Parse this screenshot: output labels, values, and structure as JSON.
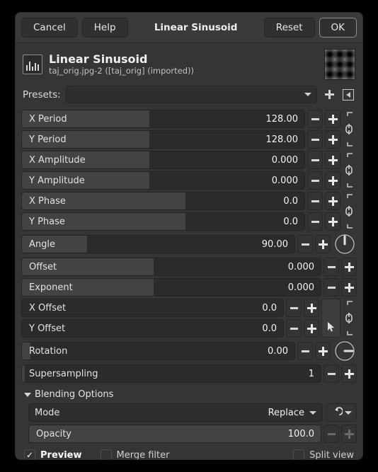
{
  "titlebar": {
    "cancel": "Cancel",
    "help": "Help",
    "title": "Linear Sinusoid",
    "reset": "Reset",
    "ok": "OK"
  },
  "info": {
    "title": "Linear Sinusoid",
    "subtitle": "taj_orig.jpg-2 ([taj_orig] (imported))"
  },
  "presets": {
    "label": "Presets:",
    "value": "",
    "add_icon": "plus-icon",
    "menu_icon": "preset-menu-icon"
  },
  "params": [
    {
      "label": "X Period",
      "value": "128.00",
      "fill": 45
    },
    {
      "label": "Y Period",
      "value": "128.00",
      "fill": 45
    },
    {
      "label": "X Amplitude",
      "value": "0.000",
      "fill": 45
    },
    {
      "label": "Y Amplitude",
      "value": "0.000",
      "fill": 45
    },
    {
      "label": "X Phase",
      "value": "0.0",
      "fill": 58
    },
    {
      "label": "Y Phase",
      "value": "0.0",
      "fill": 58
    },
    {
      "label": "Angle",
      "value": "90.00",
      "fill": 24
    },
    {
      "label": "Offset",
      "value": "0.000",
      "fill": 44
    },
    {
      "label": "Exponent",
      "value": "0.000",
      "fill": 44
    },
    {
      "label": "X Offset",
      "value": "0.0",
      "fill": 0
    },
    {
      "label": "Y Offset",
      "value": "0.0",
      "fill": 0
    },
    {
      "label": "Rotation",
      "value": "0.00",
      "fill": 3
    },
    {
      "label": "Supersampling",
      "value": "1",
      "fill": 1
    }
  ],
  "widgets": {
    "chain_icon": "chain-link-icon",
    "angle_dial_icon": "angle-dial-icon",
    "rotation_dial_icon": "rotation-dial-icon",
    "picker_icon": "pointer-picker-icon",
    "minus_icon": "minus-icon",
    "plus_icon": "plus-icon"
  },
  "blending": {
    "section_title": "Blending Options",
    "expander_icon": "triangle-down-icon",
    "mode_label": "Mode",
    "mode_value": "Replace",
    "mode_caret_icon": "chevron-down-icon",
    "revert_icon": "revert-arrow-icon",
    "revert_caret_icon": "chevron-down-icon",
    "opacity_label": "Opacity",
    "opacity_value": "100.0",
    "opacity_fill": 100
  },
  "footer": {
    "preview_label": "Preview",
    "preview_checked": true,
    "merge_label": "Merge filter",
    "merge_checked": false,
    "split_label": "Split view",
    "split_checked": false,
    "check_icon": "checkmark-icon"
  }
}
